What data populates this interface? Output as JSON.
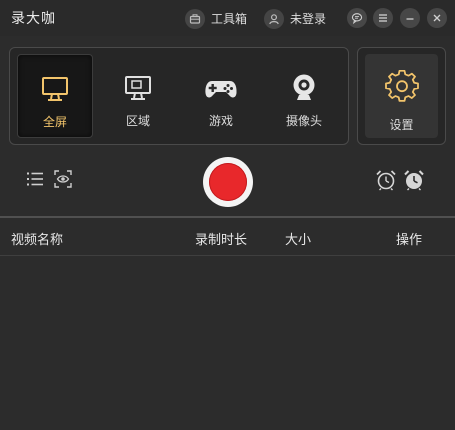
{
  "app": {
    "title": "录大咖"
  },
  "header": {
    "toolbox_label": "工具箱",
    "login_label": "未登录"
  },
  "modes": [
    {
      "label": "全屏",
      "icon": "monitor-icon",
      "active": true
    },
    {
      "label": "区域",
      "icon": "region-monitor-icon",
      "active": false
    },
    {
      "label": "游戏",
      "icon": "gamepad-icon",
      "active": false
    },
    {
      "label": "摄像头",
      "icon": "webcam-icon",
      "active": false
    }
  ],
  "settings": {
    "label": "设置"
  },
  "colors": {
    "accent": "#f2c46b",
    "record": "#e8282b",
    "background": "#2c2c2c"
  },
  "table": {
    "columns": [
      "视频名称",
      "录制时长",
      "大小",
      "操作"
    ],
    "rows": []
  }
}
